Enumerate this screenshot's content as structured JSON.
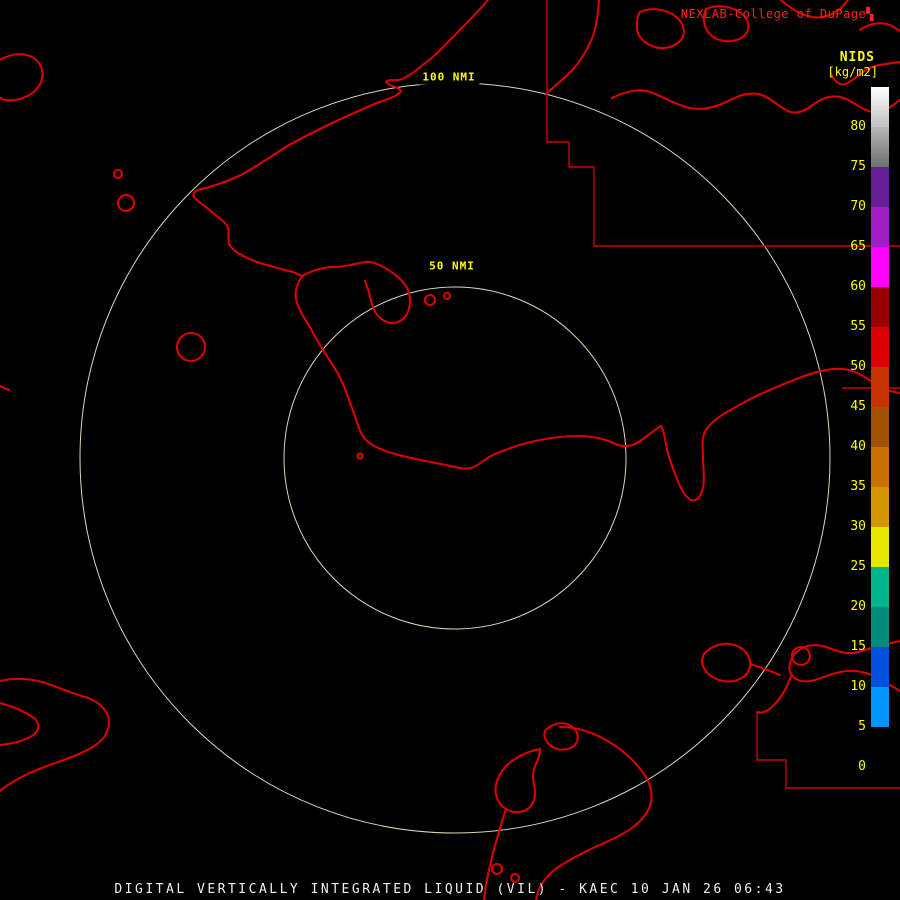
{
  "colors": {
    "background": "#000000",
    "map_line": "#dd0000",
    "boundary_line": "#cc0000",
    "ring": "#e0d5b8",
    "ring_label": "#ffff00",
    "scale_text": "#ffff00",
    "brand_text": "#ff2222",
    "footer_text": "#f0f0f0"
  },
  "header": {
    "brand": "NEXLAB-College of DuPage",
    "brand_symbol": "▚",
    "scale_title": "NIDS",
    "scale_units": "[kg/m2]"
  },
  "colorbar": {
    "tick_labels": [
      "80",
      "75",
      "70",
      "65",
      "60",
      "55",
      "50",
      "45",
      "40",
      "35",
      "30",
      "25",
      "20",
      "15",
      "10",
      "5",
      "0"
    ],
    "segments": [
      {
        "range": "above-80",
        "background": "linear-gradient(180deg,#ffffff,#c0c0c0)"
      },
      {
        "range": "75-80",
        "background": "linear-gradient(180deg,#b8b8b8,#6e6e6e)"
      },
      {
        "range": "70-75",
        "background": "#641e96"
      },
      {
        "range": "65-70",
        "background": "#a01ec8"
      },
      {
        "range": "60-65",
        "background": "#ff00ff"
      },
      {
        "range": "55-60",
        "background": "#960000"
      },
      {
        "range": "50-55",
        "background": "#dc0000"
      },
      {
        "range": "45-50",
        "background": "#c83200"
      },
      {
        "range": "40-45",
        "background": "#a05000"
      },
      {
        "range": "35-40",
        "background": "#c87000"
      },
      {
        "range": "30-35",
        "background": "#d29600"
      },
      {
        "range": "25-30",
        "background": "#e6e600"
      },
      {
        "range": "20-25",
        "background": "#00b48c"
      },
      {
        "range": "15-20",
        "background": "#008c78"
      },
      {
        "range": "10-15",
        "background": "#0050dc"
      },
      {
        "range": "5-10",
        "background": "#0096ff"
      },
      {
        "range": "0-5",
        "background": "#000000"
      },
      {
        "range": "below-0",
        "background": "#000000"
      }
    ]
  },
  "map": {
    "range_rings": [
      {
        "label": "100 NMI",
        "radius_px": 375
      },
      {
        "label": "50 NMI",
        "radius_px": 171
      }
    ]
  },
  "footer": {
    "product_line": "DIGITAL VERTICALLY INTEGRATED LIQUID (VIL) - KAEC 10 JAN 26 06:43"
  }
}
